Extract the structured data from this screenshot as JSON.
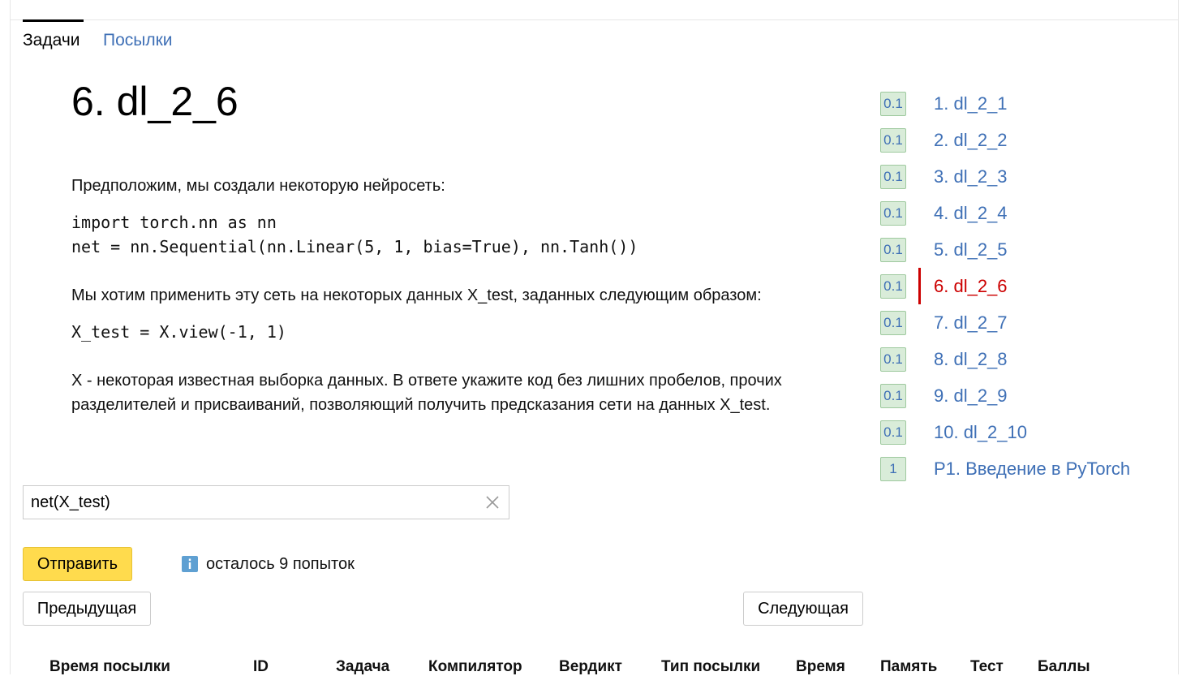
{
  "tabs": {
    "tasks": "Задачи",
    "submissions": "Посылки"
  },
  "problem": {
    "title": "6. dl_2_6",
    "intro": "Предположим, мы создали некоторую нейросеть:",
    "code1_line1": "import torch.nn as nn",
    "code1_line2": "net = nn.Sequential(nn.Linear(5, 1, bias=True), nn.Tanh())",
    "para2": "Мы хотим применить эту сеть на некоторых данных X_test, заданных следующим образом:",
    "code2": "X_test = X.view(-1, 1)",
    "para3_line1": "X - некоторая известная выборка данных. В ответе укажите код без лишних пробелов, прочих",
    "para3_line2": "разделителей и присваиваний, позволяющий получить предсказания сети на данных X_test."
  },
  "answer": {
    "value": "net(X_test)"
  },
  "buttons": {
    "submit": "Отправить",
    "previous": "Предыдущая",
    "next": "Следующая"
  },
  "attempts": {
    "icon": "info-icon",
    "text": "осталось 9 попыток"
  },
  "problem_list": [
    {
      "score": "0.1",
      "label": "1. dl_2_1",
      "active": false
    },
    {
      "score": "0.1",
      "label": "2. dl_2_2",
      "active": false
    },
    {
      "score": "0.1",
      "label": "3. dl_2_3",
      "active": false
    },
    {
      "score": "0.1",
      "label": "4. dl_2_4",
      "active": false
    },
    {
      "score": "0.1",
      "label": "5. dl_2_5",
      "active": false
    },
    {
      "score": "0.1",
      "label": "6. dl_2_6",
      "active": true
    },
    {
      "score": "0.1",
      "label": "7. dl_2_7",
      "active": false
    },
    {
      "score": "0.1",
      "label": "8. dl_2_8",
      "active": false
    },
    {
      "score": "0.1",
      "label": "9. dl_2_9",
      "active": false
    },
    {
      "score": "0.1",
      "label": "10. dl_2_10",
      "active": false
    },
    {
      "score": "1",
      "label": "P1. Введение в PyTorch",
      "active": false
    }
  ],
  "table": {
    "columns": [
      "Время посылки",
      "ID",
      "Задача",
      "Компилятор",
      "Вердикт",
      "Тип посылки",
      "Время",
      "Память",
      "Тест",
      "Баллы"
    ]
  },
  "colors": {
    "link": "#3f70b6",
    "active": "#cc0000",
    "submit_bg": "#ffdb4d",
    "badge_bg": "#d9ecd9"
  }
}
